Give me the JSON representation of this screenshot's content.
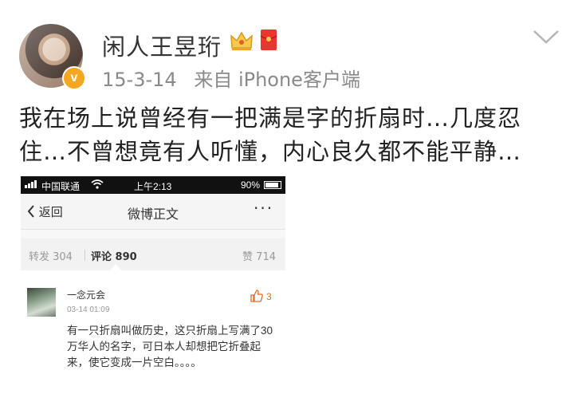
{
  "user": {
    "name": "闲人王昱珩",
    "verified_badge": "v",
    "avatar_icon": "user-avatar"
  },
  "post": {
    "date": "15-3-14",
    "source": "来自 iPhone客户端",
    "text": "我在场上说曾经有一把满是字的折扇时…几度忍住…不曾想竟有人听懂，内心良久都不能平静…"
  },
  "screenshot": {
    "status_bar": {
      "carrier": "中国联通",
      "time": "上午2:13",
      "battery": "90%",
      "battery_level": 0.9
    },
    "nav": {
      "back": "返回",
      "title": "微博正文",
      "more": "···"
    },
    "tabs": {
      "repost": "转发 304",
      "comments": "评论 890",
      "likes": "赞 714"
    },
    "comment": {
      "author": "一念元会",
      "time": "03-14 01:09",
      "likes": "3",
      "text": "有一只折扇叫做历史，这只折扇上写满了30万华人的名字，可日本人却想把它折叠起来，使它变成一片空白。。。。"
    }
  },
  "colors": {
    "accent": "#f5a623",
    "like": "#e36a2a",
    "status_bar": "#111111"
  }
}
